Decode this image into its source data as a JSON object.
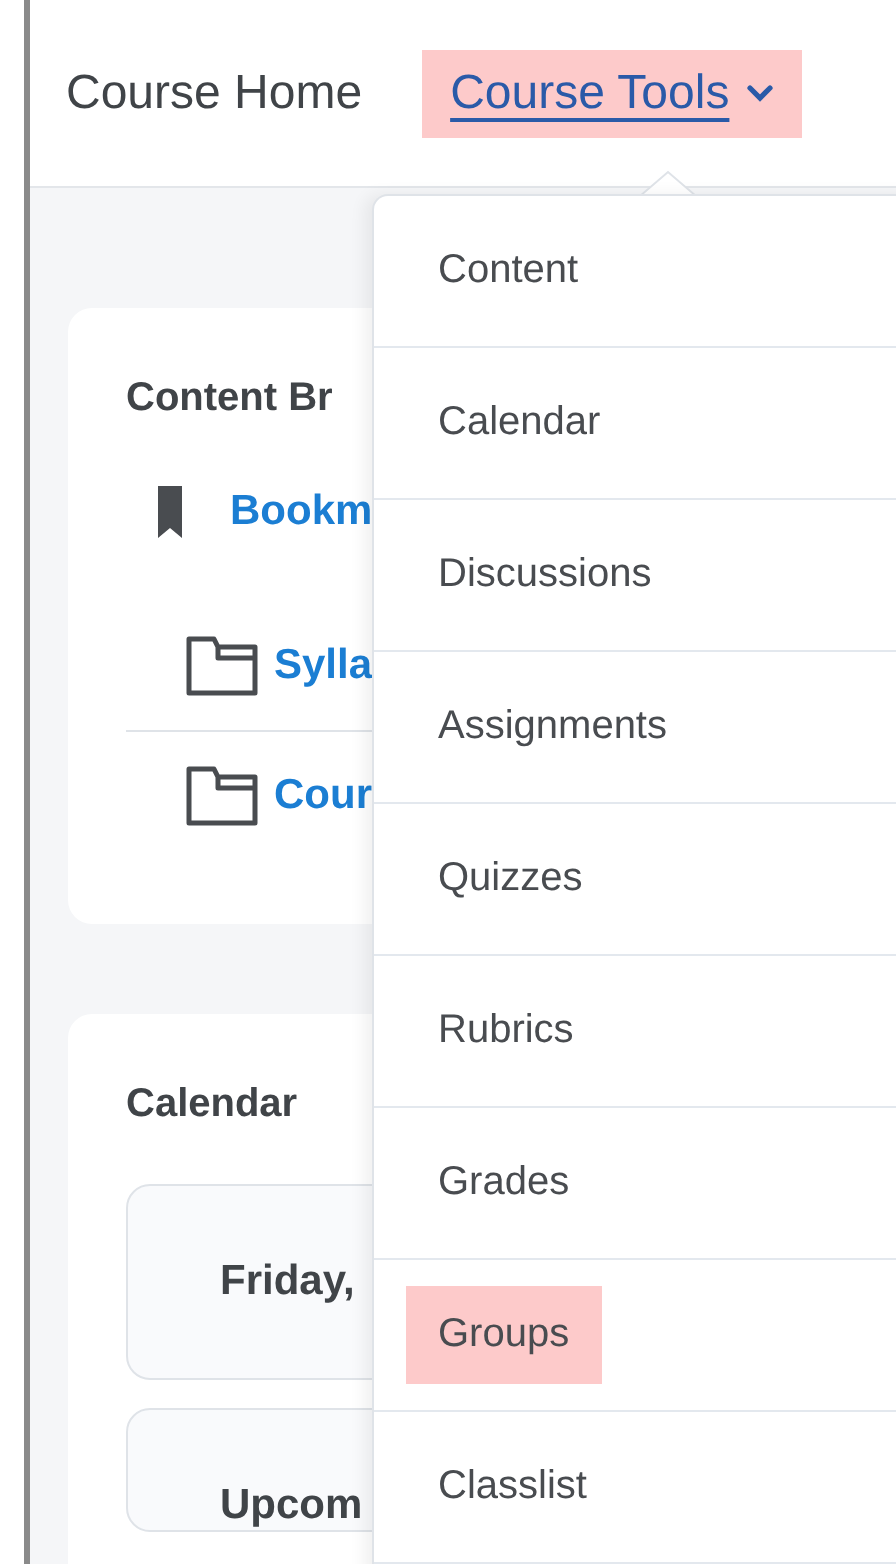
{
  "nav": [
    {
      "label": "Course Home",
      "highlighted": false,
      "dropdown": false
    },
    {
      "label": "Course Tools",
      "highlighted": true,
      "dropdown": true
    }
  ],
  "content_browser": {
    "title": "Content Br",
    "items": [
      {
        "kind": "bookmark",
        "label": "Bookm"
      },
      {
        "kind": "folder",
        "label": "Sylla"
      },
      {
        "kind": "folder",
        "label": "Cour"
      }
    ]
  },
  "calendar": {
    "title": "Calendar",
    "cards": [
      "Friday,",
      "Upcom"
    ]
  },
  "menu": {
    "items": [
      {
        "label": "Content",
        "highlighted": false
      },
      {
        "label": "Calendar",
        "highlighted": false
      },
      {
        "label": "Discussions",
        "highlighted": false
      },
      {
        "label": "Assignments",
        "highlighted": false
      },
      {
        "label": "Quizzes",
        "highlighted": false
      },
      {
        "label": "Rubrics",
        "highlighted": false
      },
      {
        "label": "Grades",
        "highlighted": false
      },
      {
        "label": "Groups",
        "highlighted": true
      },
      {
        "label": "Classlist",
        "highlighted": false
      }
    ]
  }
}
